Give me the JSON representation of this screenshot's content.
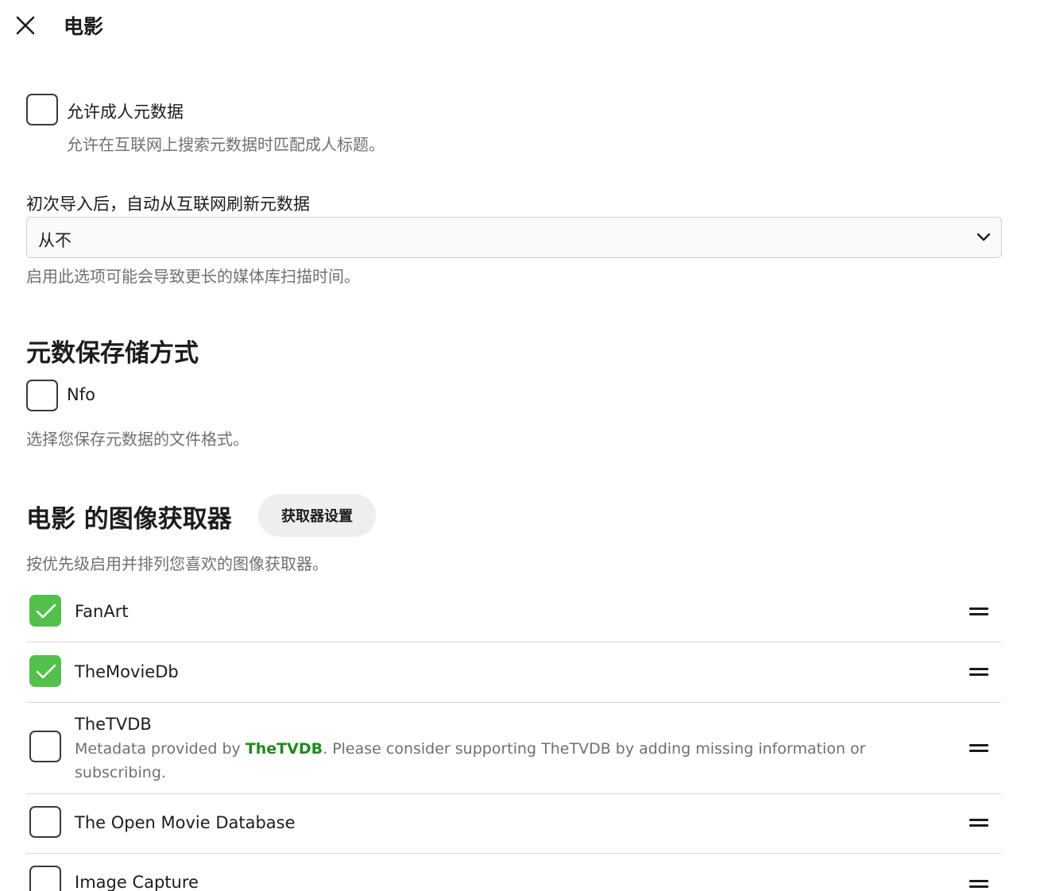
{
  "header": {
    "title": "电影"
  },
  "adult_metadata": {
    "label": "允许成人元数据",
    "help": "允许在互联网上搜索元数据时匹配成人标题。",
    "checked": false
  },
  "refresh": {
    "label": "初次导入后，自动从互联网刷新元数据",
    "selected": "从不",
    "help": "启用此选项可能会导致更长的媒体库扫描时间。"
  },
  "savers": {
    "title": "元数保存储方式",
    "items": [
      {
        "label": "Nfo",
        "checked": false
      }
    ],
    "help": "选择您保存元数据的文件格式。"
  },
  "image_fetchers": {
    "title": "电影 的图像获取器",
    "settings_button": "获取器设置",
    "help": "按优先级启用并排列您喜欢的图像获取器。",
    "items": [
      {
        "name": "FanArt",
        "checked": true
      },
      {
        "name": "TheMovieDb",
        "checked": true
      },
      {
        "name": "TheTVDB",
        "checked": false,
        "desc_prefix": "Metadata provided by ",
        "desc_link": "TheTVDB",
        "desc_suffix": ". Please consider supporting TheTVDB by adding missing information or subscribing."
      },
      {
        "name": "The Open Movie Database",
        "checked": false
      },
      {
        "name": "Image Capture",
        "checked": false
      }
    ]
  },
  "colors": {
    "accent_checked": "#52c04a",
    "link": "#1e8a1e"
  }
}
